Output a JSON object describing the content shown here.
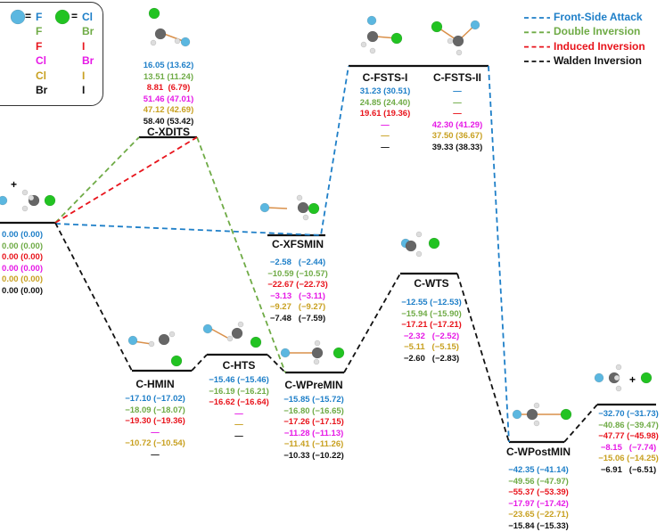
{
  "colors": [
    "#1e7fc8",
    "#6fab46",
    "#e8141c",
    "#e619e6",
    "#c8a020",
    "#111111"
  ],
  "legend_box": {
    "left_atom": "F",
    "right_atom": "Cl",
    "pairs": [
      [
        "F",
        "Cl"
      ],
      [
        "F",
        "Br"
      ],
      [
        "F",
        "I"
      ],
      [
        "Cl",
        "Br"
      ],
      [
        "Cl",
        "I"
      ],
      [
        "Br",
        "I"
      ]
    ]
  },
  "pathways": [
    {
      "label": "Front-Side Attack",
      "color": "#1e7fc8"
    },
    {
      "label": "Double Inversion",
      "color": "#6fab46"
    },
    {
      "label": "Induced Inversion",
      "color": "#e8141c"
    },
    {
      "label": "Walden Inversion",
      "color": "#111111"
    }
  ],
  "points": [
    {
      "id": "reactants",
      "name": "",
      "values": [
        "0.00 (0.00)",
        "0.00 (0.00)",
        "0.00 (0.00)",
        "0.00 (0.00)",
        "0.00 (0.00)",
        "0.00 (0.00)"
      ]
    },
    {
      "id": "xdits",
      "name": "C-XDITS",
      "values": [
        "16.05 (13.62)",
        "13.51 (11.24)",
        "8.81  (6.79)",
        "51.46 (47.01)",
        "47.12 (42.69)",
        "58.40 (53.42)"
      ]
    },
    {
      "id": "fsts1",
      "name": "C-FSTS-I",
      "values": [
        "31.23 (30.51)",
        "24.85 (24.40)",
        "19.61 (19.36)",
        "—",
        "—",
        "—"
      ]
    },
    {
      "id": "fsts2",
      "name": "C-FSTS-II",
      "values": [
        "—",
        "—",
        "—",
        "42.30 (41.29)",
        "37.50 (36.67)",
        "39.33 (38.33)"
      ]
    },
    {
      "id": "xfsmin",
      "name": "C-XFSMIN",
      "values": [
        "−2.58   (−2.44)",
        "−10.59 (−10.57)",
        "−22.67 (−22.73)",
        "−3.13   (−3.11)",
        "−9.27   (−9.27)",
        "−7.48   (−7.59)"
      ]
    },
    {
      "id": "hmin",
      "name": "C-HMIN",
      "values": [
        "−17.10 (−17.02)",
        "−18.09 (−18.07)",
        "−19.30 (−19.36)",
        "—",
        "−10.72 (−10.54)",
        "—"
      ]
    },
    {
      "id": "hts",
      "name": "C-HTS",
      "values": [
        "−15.46 (−15.46)",
        "−16.19 (−16.21)",
        "−16.62 (−16.64)",
        "—",
        "—",
        "—"
      ]
    },
    {
      "id": "wpremin",
      "name": "C-WPreMIN",
      "values": [
        "−15.85 (−15.72)",
        "−16.80 (−16.65)",
        "−17.26 (−17.15)",
        "−11.28 (−11.13)",
        "−11.41 (−11.26)",
        "−10.33 (−10.22)"
      ]
    },
    {
      "id": "wts",
      "name": "C-WTS",
      "values": [
        "−12.55 (−12.53)",
        "−15.94 (−15.90)",
        "−17.21 (−17.21)",
        "−2.32   (−2.52)",
        "−5.11   (−5.15)",
        "−2.60   (−2.83)"
      ]
    },
    {
      "id": "wpostmin",
      "name": "C-WPostMIN",
      "values": [
        "−42.35 (−41.14)",
        "−49.56 (−47.97)",
        "−55.37 (−53.39)",
        "−17.97 (−17.42)",
        "−23.65 (−22.71)",
        "−15.84 (−15.33)"
      ]
    },
    {
      "id": "products",
      "name": "",
      "values": [
        "−32.70 (−31.73)",
        "−40.86 (−39.47)",
        "−47.77 (−45.98)",
        "−8.15   (−7.74)",
        "−15.06 (−14.25)",
        "−6.91   (−6.51)"
      ]
    }
  ],
  "plus_sign": "+"
}
